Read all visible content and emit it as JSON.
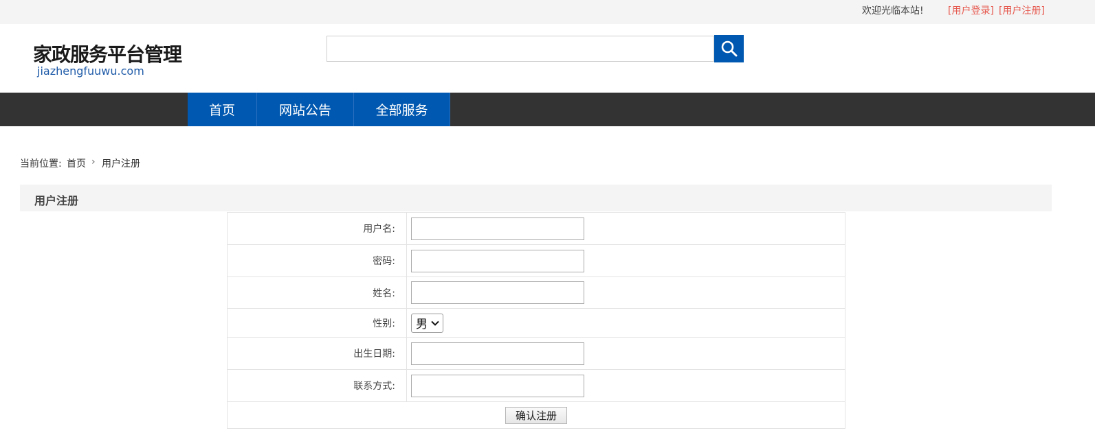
{
  "topbar": {
    "welcome": "欢迎光临本站!",
    "login": "[用户登录]",
    "register": "[用户注册]"
  },
  "logo": {
    "title": "家政服务平台管理",
    "subtitle": "jiazhengfuuwu.com"
  },
  "search": {
    "placeholder": "",
    "icon": "search-icon"
  },
  "nav": {
    "items": [
      "首页",
      "网站公告",
      "全部服务"
    ]
  },
  "breadcrumb": {
    "prefix": "当前位置:",
    "home": "首页",
    "separator": "›",
    "current": "用户注册"
  },
  "section": {
    "title": "用户注册"
  },
  "form": {
    "username_label": "用户名:",
    "password_label": "密码:",
    "name_label": "姓名:",
    "gender_label": "性别:",
    "gender_value": "男",
    "birthday_label": "出生日期:",
    "contact_label": "联系方式:",
    "submit_label": "确认注册"
  },
  "colors": {
    "accent": "#0058b0",
    "nav_bg": "#333333",
    "link": "#e6574d",
    "topbar_bg": "#f4f4f4"
  }
}
